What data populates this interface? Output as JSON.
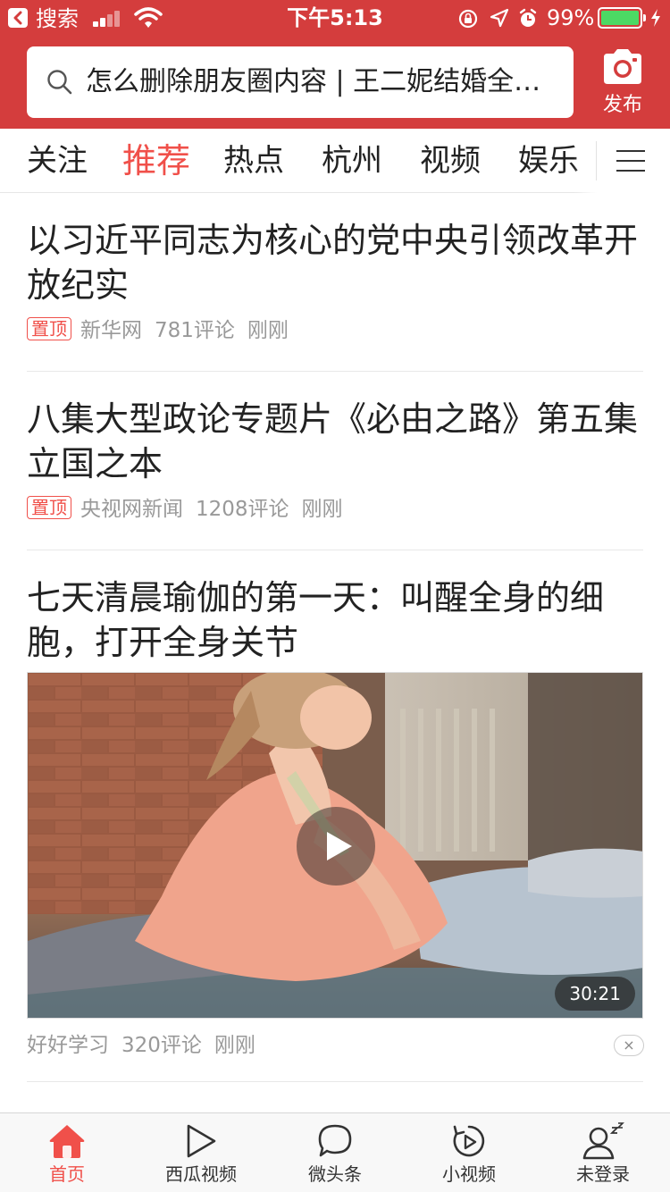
{
  "status_bar": {
    "back_label": "搜索",
    "time": "下午5:13",
    "battery_percent_text": "99%",
    "battery_level": 0.99,
    "icons": [
      "back-app-icon",
      "signal-icon",
      "wifi-icon",
      "orientation-lock-icon",
      "location-icon",
      "alarm-icon",
      "battery-icon",
      "charging-icon"
    ]
  },
  "header": {
    "search_text": "怎么删除朋友圈内容 | 王二妮结婚全…",
    "publish_label": "发布",
    "brand_color": "#d43d3d"
  },
  "tabs": {
    "items": [
      {
        "label": "关注",
        "active": false
      },
      {
        "label": "推荐",
        "active": true
      },
      {
        "label": "热点",
        "active": false
      },
      {
        "label": "杭州",
        "active": false
      },
      {
        "label": "视频",
        "active": false
      },
      {
        "label": "娱乐",
        "active": false
      }
    ],
    "active_color": "#f0504a"
  },
  "feed": {
    "articles": [
      {
        "title": "以习近平同志为核心的党中央引领改革开放纪实",
        "badge": "置顶",
        "source": "新华网",
        "comments": "781评论",
        "time": "刚刚"
      },
      {
        "title": "八集大型政论专题片《必由之路》第五集 立国之本",
        "badge": "置顶",
        "source": "央视网新闻",
        "comments": "1208评论",
        "time": "刚刚"
      },
      {
        "title": "七天清晨瑜伽的第一天：叫醒全身的细胞，打开全身关节",
        "source": "好好学习",
        "comments": "320评论",
        "time": "刚刚",
        "video_duration": "30:21",
        "dismiss_glyph": "×"
      }
    ]
  },
  "tabbar": {
    "items": [
      {
        "label": "首页",
        "icon": "home-icon",
        "active": true
      },
      {
        "label": "西瓜视频",
        "icon": "play-icon",
        "active": false
      },
      {
        "label": "微头条",
        "icon": "chat-bubble-icon",
        "active": false
      },
      {
        "label": "小视频",
        "icon": "short-video-icon",
        "active": false
      },
      {
        "label": "未登录",
        "icon": "user-sleep-icon",
        "active": false
      }
    ]
  }
}
